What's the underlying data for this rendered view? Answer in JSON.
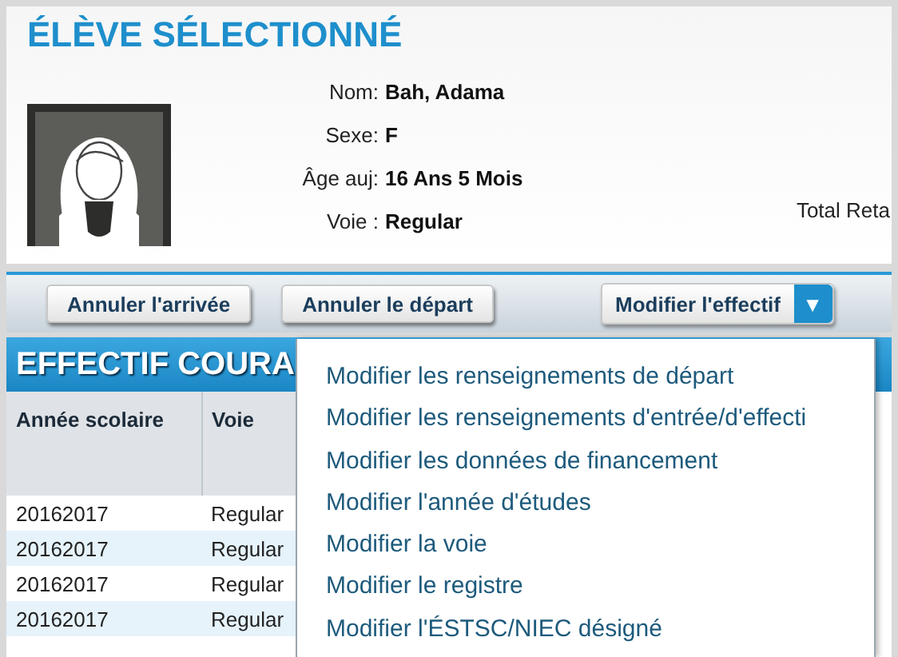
{
  "student_panel": {
    "title": "ÉLÈVE SÉLECTIONNÉ",
    "fields": [
      {
        "label": "Nom:",
        "value": "Bah, Adama"
      },
      {
        "label": "Sexe:",
        "value": "F"
      },
      {
        "label": "Âge auj:",
        "value": "16 Ans 5 Mois"
      },
      {
        "label": "Voie :",
        "value": "Regular"
      }
    ],
    "side_label": "Total Reta"
  },
  "toolbar": {
    "buttons": [
      "Annuler l'arrivée",
      "Annuler le départ"
    ],
    "dropdown": {
      "label": "Modifier l'effectif",
      "expanded": true,
      "arrow": "▼"
    }
  },
  "menu": {
    "items": [
      "Modifier les renseignements de départ",
      "Modifier les renseignements d'entrée/d'effecti",
      "Modifier les données de financement",
      "Modifier l'année d'études",
      "Modifier la voie",
      "Modifier le registre",
      "Modifier l'ÉSTSC/NIEC désigné"
    ]
  },
  "section": {
    "title": "EFFECTIF COURA",
    "table": {
      "columns": [
        "Année scolaire",
        "Voie"
      ],
      "rows": [
        [
          "20162017",
          "Regular"
        ],
        [
          "20162017",
          "Regular"
        ],
        [
          "20162017",
          "Regular"
        ],
        [
          "20162017",
          "Regular"
        ]
      ]
    }
  }
}
